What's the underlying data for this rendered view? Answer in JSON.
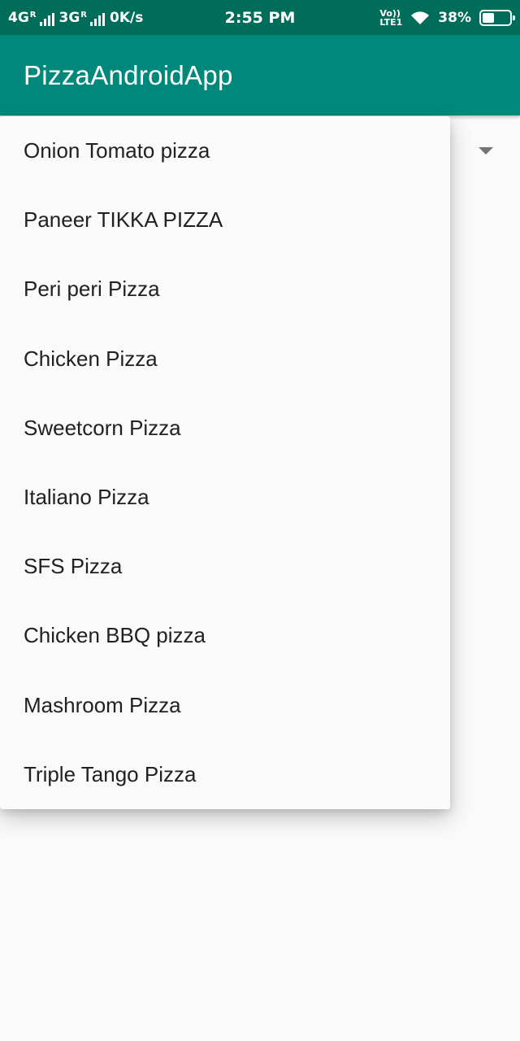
{
  "status_bar": {
    "network_1": "4G",
    "network_1_roaming": "R",
    "network_2": "3G",
    "network_2_roaming": "R",
    "data_speed": "0K/s",
    "time": "2:55 PM",
    "volte_top": "Vo))",
    "volte_bottom": "LTE1",
    "battery_percent": "38%",
    "battery_level": 0.38
  },
  "app_bar": {
    "title": "PizzaAndroidApp",
    "color": "#00897b"
  },
  "spinner": {
    "arrow_icon": "dropdown-arrow-icon",
    "options": [
      "Onion Tomato pizza",
      "Paneer TIKKA PIZZA",
      "Peri peri Pizza",
      "Chicken Pizza",
      "Sweetcorn Pizza",
      "Italiano Pizza",
      "SFS Pizza",
      "Chicken BBQ pizza",
      "Mashroom Pizza",
      "Triple Tango Pizza"
    ]
  }
}
